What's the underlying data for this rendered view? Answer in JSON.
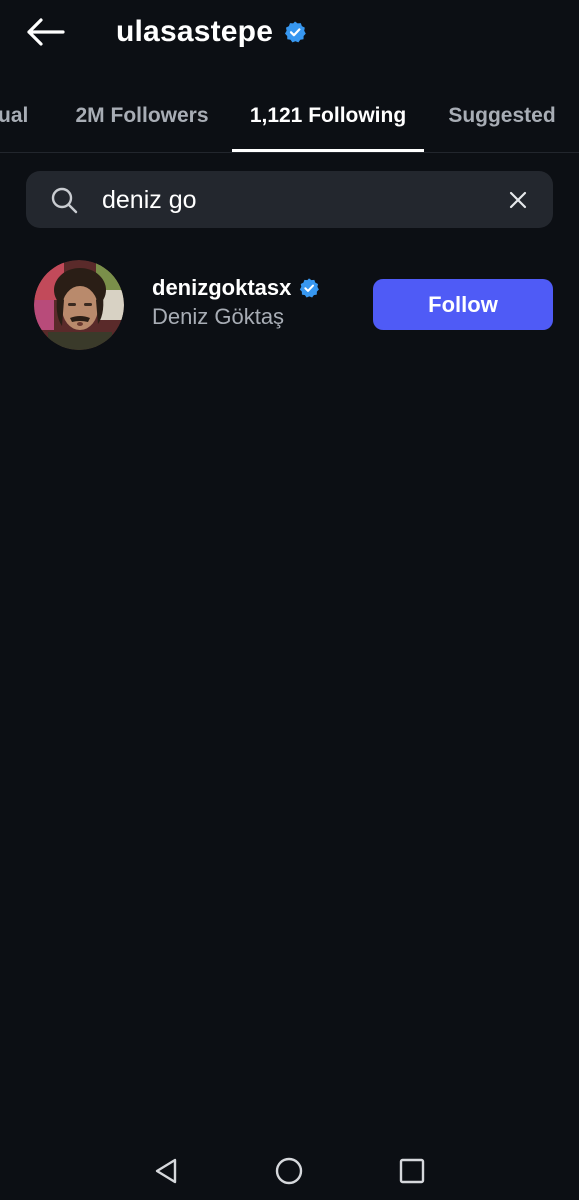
{
  "header": {
    "title": "ulasastepe",
    "back_icon": "arrow-left-icon",
    "verified_icon": "verified-badge-icon"
  },
  "tabs": [
    {
      "label": "ual",
      "active": false
    },
    {
      "label": "2M Followers",
      "active": false
    },
    {
      "label": "1,121 Following",
      "active": true
    },
    {
      "label": "Suggested",
      "active": false
    }
  ],
  "search": {
    "value": "deniz go",
    "icon": "search-icon",
    "clear_icon": "close-icon"
  },
  "results": [
    {
      "username": "denizgoktasx",
      "full_name": "Deniz Göktaş",
      "verified": true,
      "follow_label": "Follow"
    }
  ],
  "system_nav": {
    "back_icon": "triangle-back-icon",
    "home_icon": "circle-home-icon",
    "recents_icon": "square-recents-icon"
  },
  "colors": {
    "background": "#0c0f14",
    "accent": "#4f5bf6",
    "verified": "#3797f0",
    "search_bg": "#23272e",
    "muted_text": "#a8adb5"
  }
}
